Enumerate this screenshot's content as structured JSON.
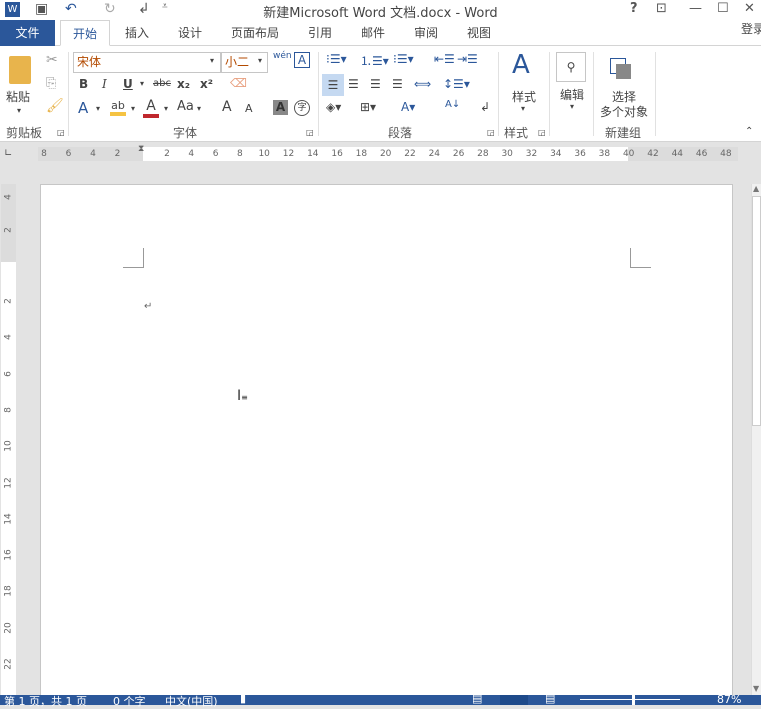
{
  "window": {
    "title": "新建Microsoft Word 文档.docx - Word",
    "help": "?",
    "restore_ribbon": "⊡",
    "minimize": "—",
    "maximize": "☐",
    "close": "✕"
  },
  "quick_access": {
    "word_icon": "W",
    "save": "💾",
    "undo": "↶",
    "redo": "↻",
    "customize": "⇂"
  },
  "tabs": {
    "file": "文件",
    "items": [
      "开始",
      "插入",
      "设计",
      "页面布局",
      "引用",
      "邮件",
      "审阅",
      "视图"
    ],
    "signin": "登录"
  },
  "ribbon": {
    "clipboard": {
      "paste": "粘贴",
      "label": "剪贴板"
    },
    "font": {
      "name": "宋体",
      "size": "小二",
      "bold": "B",
      "italic": "I",
      "underline": "U",
      "strike": "abc",
      "sub": "x₂",
      "sup": "x²",
      "text_effect": "A",
      "highlight": "ab",
      "font_color": "A",
      "case": "Aa",
      "grow": "A",
      "shrink": "A",
      "shade": "A",
      "enclose": "字",
      "phonetic": "wén",
      "border_char": "A",
      "label": "字体"
    },
    "paragraph": {
      "label": "段落"
    },
    "styles": {
      "button": "样式",
      "label": "样式"
    },
    "editing": {
      "button": "编辑"
    },
    "newgroup": {
      "button_line1": "选择",
      "button_line2": "多个对象",
      "label": "新建组"
    },
    "colors": {
      "highlight": "#f5c342",
      "font_color": "#c0282d",
      "accent": "#2b579a"
    }
  },
  "ruler": {
    "left_labels": [
      "8",
      "6",
      "4",
      "2"
    ],
    "right_labels": [
      "2",
      "4",
      "6",
      "8",
      "10",
      "12",
      "14",
      "16",
      "18",
      "20",
      "22",
      "24",
      "26",
      "28",
      "30",
      "32",
      "34",
      "36",
      "38",
      "40",
      "42",
      "44",
      "46",
      "48"
    ],
    "vertical_top": [
      "4",
      "2"
    ],
    "vertical": [
      "2",
      "4",
      "6",
      "8",
      "10",
      "12",
      "14",
      "16",
      "18",
      "20",
      "22"
    ]
  },
  "document": {
    "paragraph_mark": "↵"
  },
  "status": {
    "page": "第 1 页，共 1 页",
    "words": "0 个字",
    "language": "中文(中国)",
    "zoom": "87%"
  }
}
